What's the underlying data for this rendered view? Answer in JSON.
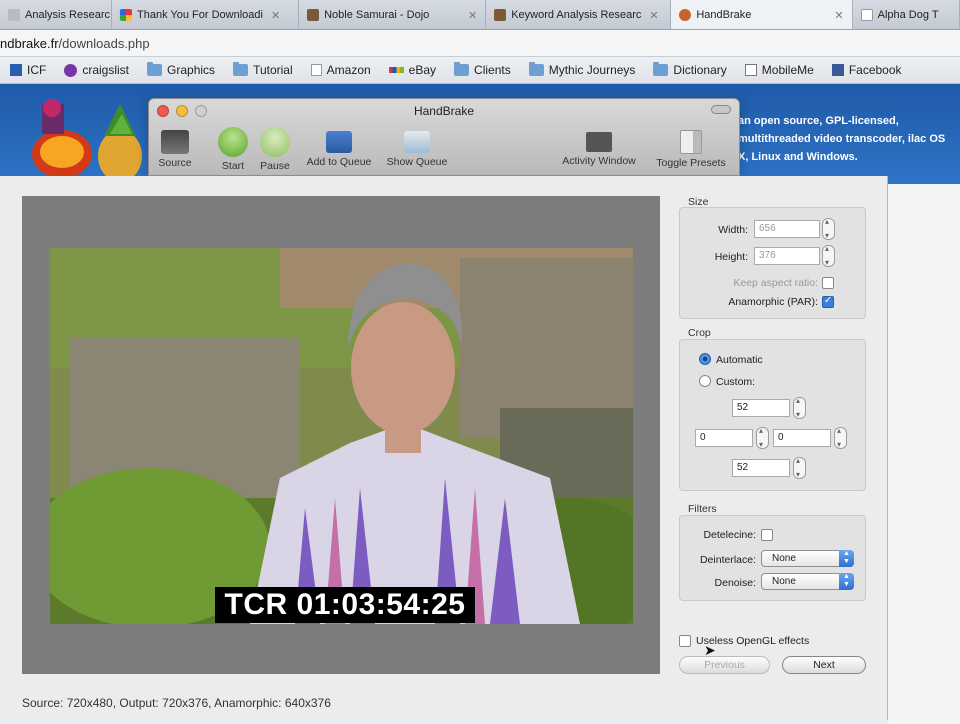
{
  "browser": {
    "tabs": [
      {
        "label": "Analysis Researc",
        "icon": "page-icon"
      },
      {
        "label": "Thank You For Downloadi",
        "icon": "google-icon"
      },
      {
        "label": "Noble Samurai - Dojo",
        "icon": "samurai-icon"
      },
      {
        "label": "Keyword Analysis Researc",
        "icon": "samurai-icon"
      },
      {
        "label": "HandBrake",
        "icon": "handbrake-icon",
        "active": true
      },
      {
        "label": "Alpha Dog T",
        "icon": "page-icon"
      }
    ],
    "url_host": "ndbrake.fr",
    "url_path": "/downloads.php",
    "bookmarks": [
      "ICF",
      "craigslist",
      "Graphics",
      "Tutorial",
      "Amazon",
      "eBay",
      "Clients",
      "Mythic Journeys",
      "Dictionary",
      "MobileMe",
      "Facebook"
    ]
  },
  "site": {
    "description": "an open source, GPL-licensed, multithreaded video transcoder, ilac OS X, Linux and Windows."
  },
  "handbrake": {
    "title": "HandBrake",
    "toolbar": [
      "Source",
      "Start",
      "Pause",
      "Add to Queue",
      "Show Queue",
      "Activity Window",
      "Toggle Presets"
    ]
  },
  "preview": {
    "timecode": "TCR 01:03:54:25",
    "status": "Source: 720x480, Output: 720x376, Anamorphic: 640x376",
    "opengl_label": "Useless OpenGL effects",
    "previous_label": "Previous",
    "next_label": "Next"
  },
  "settings": {
    "size": {
      "title": "Size",
      "width_label": "Width:",
      "width_value": "656",
      "height_label": "Height:",
      "height_value": "376",
      "keep_aspect_label": "Keep aspect ratio:",
      "keep_aspect_checked": false,
      "anamorphic_label": "Anamorphic (PAR):",
      "anamorphic_checked": true
    },
    "crop": {
      "title": "Crop",
      "automatic_label": "Automatic",
      "custom_label": "Custom:",
      "mode": "Automatic",
      "top": "52",
      "left": "0",
      "right": "0",
      "bottom": "52"
    },
    "filters": {
      "title": "Filters",
      "detelecine_label": "Detelecine:",
      "detelecine_checked": false,
      "deinterlace_label": "Deinterlace:",
      "deinterlace_value": "None",
      "denoise_label": "Denoise:",
      "denoise_value": "None"
    }
  },
  "colors": {
    "site_blue": "#2d73c7",
    "accent_blue": "#3a7fd9"
  }
}
